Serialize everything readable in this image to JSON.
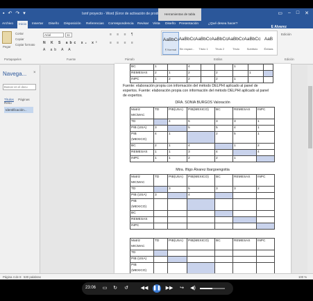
{
  "window": {
    "title": "Ismf proyecto - Word (Error de activación de productos)",
    "context_tab": "Herramientas de tabla",
    "user": "E Alvarez",
    "tell_me": "¿Qué desea hacer?"
  },
  "ribbon_tabs": [
    "Archivo",
    "Inicio",
    "Insertar",
    "Diseño",
    "Disposición",
    "Referencias",
    "Correspondencia",
    "Revisar",
    "Vista",
    "Diseño",
    "Presentación"
  ],
  "clipboard": {
    "paste": "Pegar",
    "cut": "Cortar",
    "copy": "Copiar",
    "format_painter": "Copiar formato"
  },
  "font": {
    "name": "Arial",
    "size": "11",
    "format_row": "N K S abc x₂ x²",
    "format_row2": "A ab A A"
  },
  "paragraph": {
    "row1": "≡ ≡ ≡ ¶",
    "row2": "≡ ≡ ≡ ≡"
  },
  "styles": [
    {
      "preview": "AaBbCcDc",
      "label": "¶ Normal",
      "active": true
    },
    {
      "preview": "AaBbCc",
      "label": "Sin espaci...",
      "active": false
    },
    {
      "preview": "AaBbCcDc",
      "label": "Título 1",
      "active": false
    },
    {
      "preview": "AaBbCcD",
      "label": "Título 2",
      "active": false
    },
    {
      "preview": "AaBbCcC",
      "label": "Título",
      "active": false
    },
    {
      "preview": "AaBbCcD",
      "label": "Subtítulo",
      "active": false
    },
    {
      "preview": "AaB",
      "label": "Énfasis",
      "active": false
    }
  ],
  "editing_label": "Edición",
  "group_labels": {
    "clipboard": "Portapapeles",
    "font": "Fuente",
    "paragraph": "Párrafo",
    "styles": "Estilos",
    "editing": "Edición"
  },
  "navigation": {
    "title": "Navega...",
    "close": "×",
    "search_placeholder": "Buscar en el docu",
    "tabs": [
      "Títulos",
      "Páginas",
      "Resu"
    ],
    "heading": "Identificación..."
  },
  "document": {
    "top_table": {
      "rows": [
        [
          "BC",
          "1",
          "",
          "4",
          "",
          "",
          "1",
          "",
          ""
        ],
        [
          "REMESAS",
          "2",
          "1",
          "2",
          "",
          "2",
          "",
          "1",
          ""
        ],
        [
          "INPC",
          "1",
          "2",
          "2",
          "",
          "2",
          "1",
          "",
          ""
        ]
      ]
    },
    "source_lines": [
      "Fuente: elaboración propia con información del método DELPHI aplicado al panel de",
      "expertos. Fuente: elaboración propia con información del método DELPHI aplicado al panel",
      "de expertos."
    ],
    "table1": {
      "title": "DRA. SONIA BURGOS Valoración",
      "header": [
        "Matriz MICMAC",
        "TD",
        "PIB(USA)",
        "PIB(MEXICO)",
        "BC",
        "REMESAS",
        "INPC"
      ],
      "rows": [
        [
          "TD",
          "",
          "4",
          "5",
          "3",
          "3",
          "1"
        ],
        [
          "PIB (USA)",
          "3",
          "",
          "5",
          "5",
          "4",
          "1"
        ],
        [
          "PIB (MEXICO)",
          "4",
          "1",
          "",
          "2",
          "5",
          "1"
        ],
        [
          "BC",
          "2",
          "1",
          "4",
          "",
          "1",
          "2"
        ],
        [
          "REMESAS",
          "1",
          "1",
          "3",
          "4",
          "",
          "4"
        ],
        [
          "INPC",
          "1",
          "1",
          "2",
          "2",
          "1",
          ""
        ]
      ]
    },
    "table2": {
      "title": "Mtra. Iñigo Álvarez Ibargoengoitia",
      "header": [
        "Matriz MICMAC",
        "TD",
        "PIB(USA)",
        "PIB(MEXICO)",
        "BC",
        "REMESAS",
        "INPC"
      ],
      "rows": [
        [
          "TD",
          "",
          "3",
          "5",
          "3",
          "3",
          "2"
        ],
        [
          "PIB (USA)",
          "3",
          "",
          "4",
          "",
          "",
          ""
        ],
        [
          "PIB (MEXICO)",
          "",
          "",
          "",
          "",
          "",
          ""
        ],
        [
          "BC",
          "",
          "",
          "",
          "",
          "",
          ""
        ],
        [
          "REMESAS",
          "",
          "",
          "",
          "",
          "",
          ""
        ],
        [
          "INPC",
          "",
          "",
          "",
          "",
          "",
          ""
        ]
      ]
    },
    "table3": {
      "header": [
        "Matriz MICMAC",
        "TD",
        "PIB(USA)",
        "PIB(MEXICO)",
        "BC",
        "REMESAS",
        "INPC"
      ],
      "rows": [
        [
          "TD",
          "",
          "",
          "",
          "",
          "",
          ""
        ],
        [
          "PIB (USA)",
          "",
          "",
          "",
          "",
          "",
          ""
        ],
        [
          "PIB (MEXICO)",
          "",
          "",
          "",
          "",
          "",
          ""
        ]
      ]
    }
  },
  "status": {
    "page": "Página 4 de 8",
    "words": "530 palabras",
    "zoom": "100 %"
  },
  "player": {
    "time": "23:06",
    "progress": 0.5
  }
}
